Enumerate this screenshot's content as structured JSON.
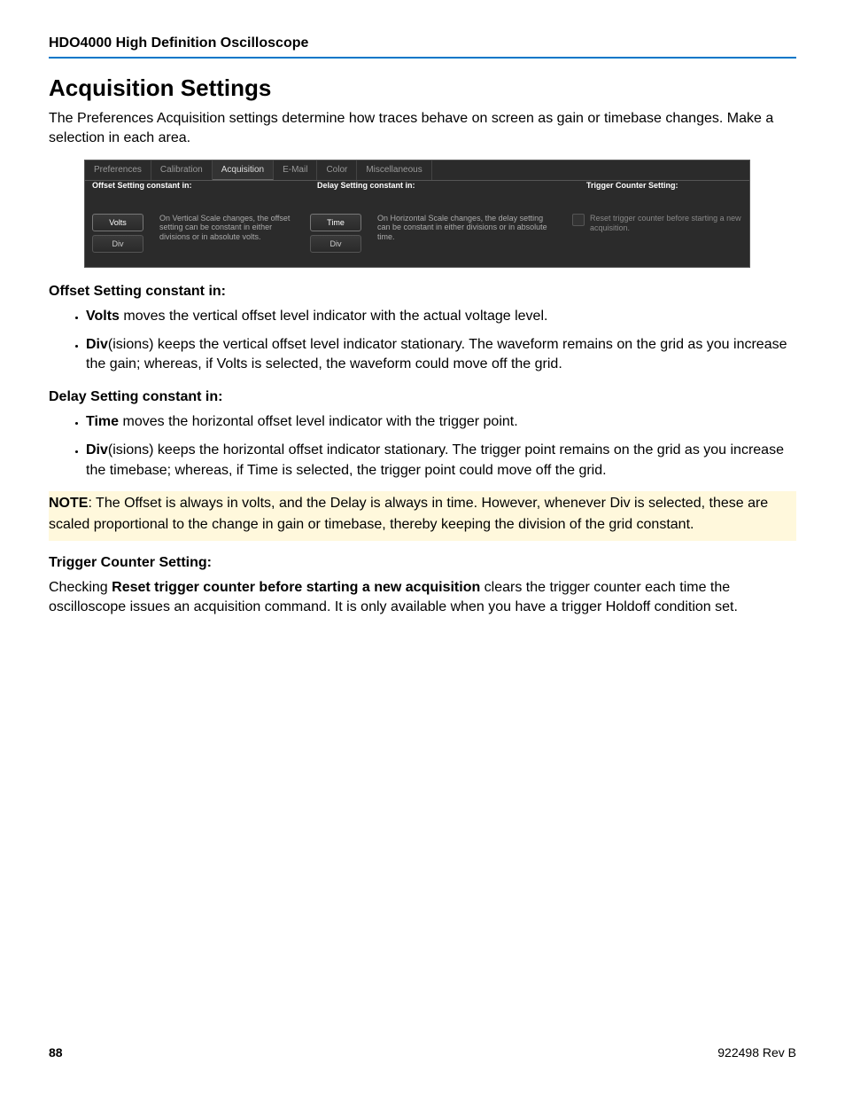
{
  "header": "HDO4000 High Definition Oscilloscope",
  "title": "Acquisition Settings",
  "intro": "The Preferences Acquisition settings determine how traces behave on screen as gain or timebase changes. Make a selection in each area.",
  "screenshot": {
    "tabs": [
      "Preferences",
      "Calibration",
      "Acquisition",
      "E-Mail",
      "Color",
      "Miscellaneous"
    ],
    "activeTab": "Acquisition",
    "offset": {
      "label": "Offset Setting constant in:",
      "btn1": "Volts",
      "btn2": "Div",
      "help": "On Vertical Scale changes, the offset setting can be constant in either divisions or in absolute volts."
    },
    "delay": {
      "label": "Delay Setting constant in:",
      "btn1": "Time",
      "btn2": "Div",
      "help": "On Horizontal Scale changes,\nthe delay setting can be constant in either divisions or in absolute time."
    },
    "trigger": {
      "label": "Trigger Counter Setting:",
      "check": "Reset trigger counter before starting a new acquisition."
    }
  },
  "section1": {
    "head": "Offset Setting constant in:",
    "b1_bold": "Volts",
    "b1_text": " moves the vertical offset level indicator with the actual voltage level.",
    "b2_bold": "Div",
    "b2_text": "(isions) keeps the vertical offset level indicator stationary. The waveform remains on the grid as you increase the gain; whereas, if Volts is selected, the waveform could move off the grid."
  },
  "section2": {
    "head": "Delay Setting constant in:",
    "b1_bold": "Time",
    "b1_text": " moves the horizontal offset level indicator with the trigger point.",
    "b2_bold": "Div",
    "b2_text": "(isions) keeps the horizontal offset indicator stationary. The trigger point remains on the grid as you increase the timebase; whereas, if Time is selected, the trigger point could move off the grid."
  },
  "note_label": "NOTE",
  "note_text": ": The Offset is always in volts, and the Delay is always in time. However, whenever Div is selected, these are scaled proportional to the change in gain or timebase, thereby keeping the division of the grid constant.",
  "section3": {
    "head": "Trigger Counter Setting:",
    "pre": "Checking ",
    "bold": "Reset trigger counter before starting a new acquisition",
    "post": " clears the trigger counter each time the oscilloscope issues an acquisition command. It is only available when you have a trigger Holdoff condition set."
  },
  "footer": {
    "page": "88",
    "rev": "922498 Rev B"
  }
}
